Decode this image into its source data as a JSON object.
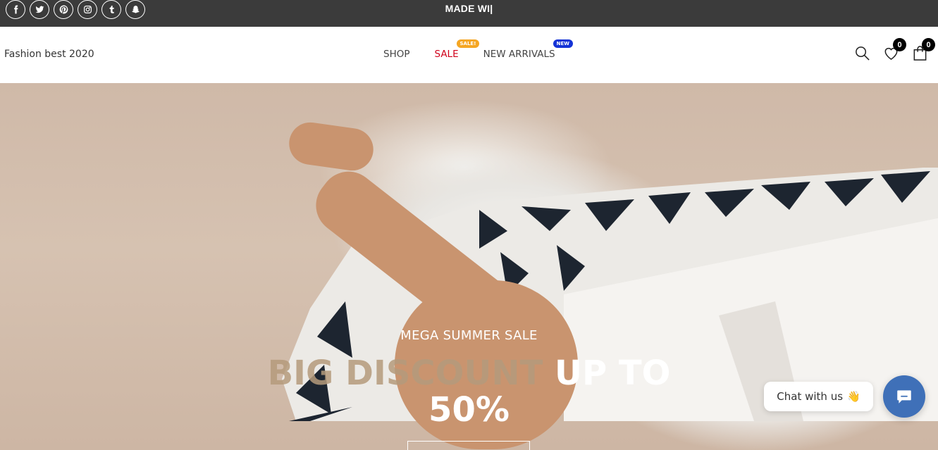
{
  "topbar": {
    "announcement": "MADE WI|",
    "socials": [
      {
        "name": "facebook-icon",
        "glyph": "f"
      },
      {
        "name": "twitter-icon",
        "glyph": "t"
      },
      {
        "name": "pinterest-icon",
        "glyph": "p"
      },
      {
        "name": "instagram-icon",
        "glyph": "i"
      },
      {
        "name": "tumblr-icon",
        "glyph": "t"
      },
      {
        "name": "snapchat-icon",
        "glyph": "s"
      }
    ]
  },
  "header": {
    "logo": "Fashion best 2020",
    "nav": {
      "shop": "SHOP",
      "sale": "SALE",
      "sale_badge": "SALE!",
      "new_arrivals": "NEW ARRIVALS",
      "new_badge": "NEW"
    },
    "wishlist_count": "0",
    "cart_count": "0"
  },
  "hero": {
    "subtitle": "MEGA SUMMER SALE",
    "title_highlight": "BIG DISCOUNT",
    "title_rest": " UP TO",
    "title_line2": "50%"
  },
  "chat": {
    "label": "Chat with us",
    "emoji": "👋"
  },
  "colors": {
    "topbar_bg": "#3b3b3b",
    "sale_red": "#d0021b",
    "sale_badge": "#f5a623",
    "new_badge": "#1433d6",
    "chat_button": "#3f70b8"
  }
}
